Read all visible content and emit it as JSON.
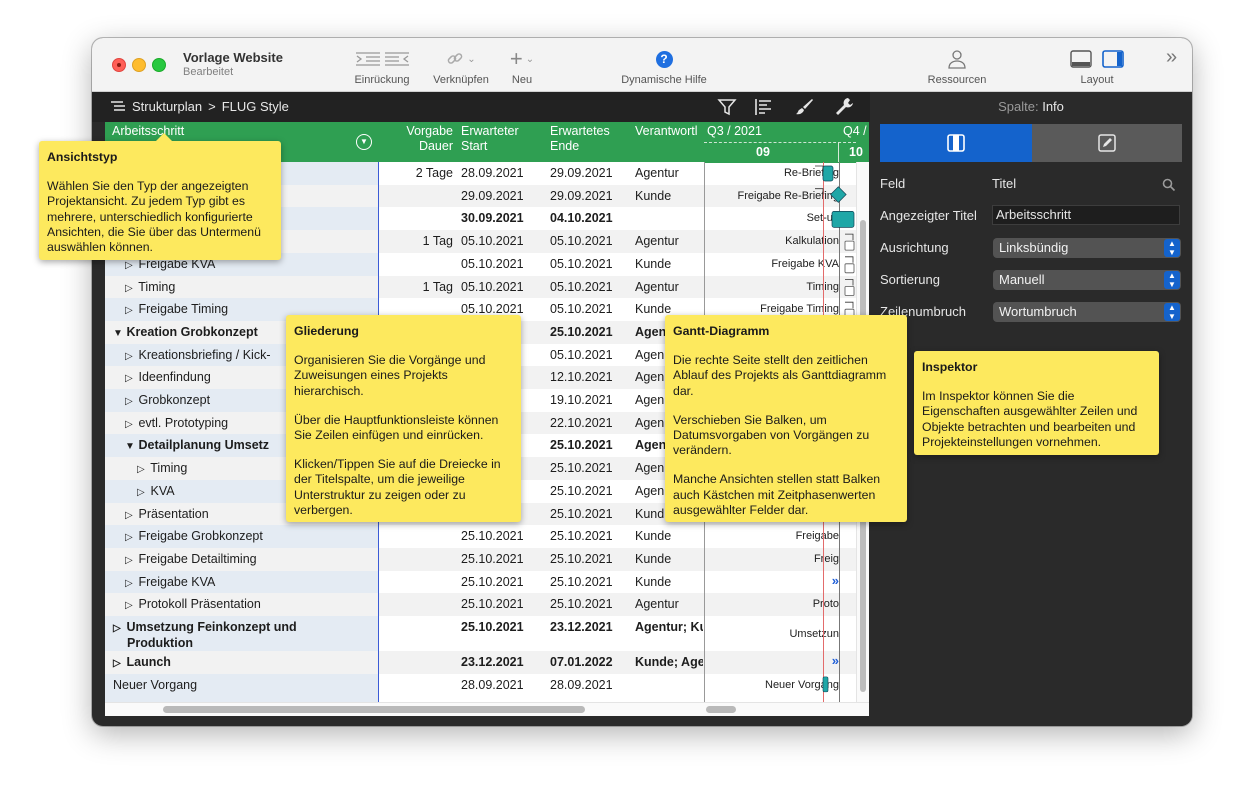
{
  "window": {
    "title": "Vorlage Website",
    "subtitle": "Bearbeitet"
  },
  "toolbar": {
    "indent_label": "Einrückung",
    "link_label": "Verknüpfen",
    "new_label": "Neu",
    "help_label": "Dynamische Hilfe",
    "resources_label": "Ressourcen",
    "layout_label": "Layout",
    "overflow": "»"
  },
  "header": {
    "view_name": "Strukturplan",
    "separator": ">",
    "style_name": "FLUG Style"
  },
  "columns": {
    "title": "Arbeitsschritt",
    "duration_1": "Vorgabe",
    "duration_2": "Dauer",
    "start_1": "Erwarteter",
    "start_2": "Start",
    "end_1": "Erwartetes",
    "end_2": "Ende",
    "resp": "Verantwortl",
    "quarter_1": "Q3 / 2021",
    "quarter_2": "Q4 /",
    "month_1": "09",
    "month_2": "10"
  },
  "rows": [
    {
      "title": "",
      "dur": "2 Tage",
      "start": "28.09.2021",
      "end": "29.09.2021",
      "resp": "Agentur",
      "gantt": "Re-Briefing",
      "bold": false
    },
    {
      "title": "",
      "dur": "",
      "start": "29.09.2021",
      "end": "29.09.2021",
      "resp": "Kunde",
      "gantt": "Freigabe Re-Briefing",
      "bold": false
    },
    {
      "title": "",
      "dur": "",
      "start": "30.09.2021",
      "end": "04.10.2021",
      "resp": "",
      "gantt": "Set-up",
      "bold": true
    },
    {
      "title": "",
      "dur": "1 Tag",
      "start": "05.10.2021",
      "end": "05.10.2021",
      "resp": "Agentur",
      "gantt": "Kalkulation",
      "bold": false
    },
    {
      "title": "Freigabe KVA",
      "dur": "",
      "start": "05.10.2021",
      "end": "05.10.2021",
      "resp": "Kunde",
      "gantt": "Freigabe KVA",
      "bold": false
    },
    {
      "title": "Timing",
      "dur": "1 Tag",
      "start": "05.10.2021",
      "end": "05.10.2021",
      "resp": "Agentur",
      "gantt": "Timing",
      "bold": false
    },
    {
      "title": "Freigabe Timing",
      "dur": "",
      "start": "05.10.2021",
      "end": "05.10.2021",
      "resp": "Kunde",
      "gantt": "Freigabe Timing",
      "bold": false
    },
    {
      "title": "Kreation Grobkonzept",
      "dur": "",
      "start": "",
      "end": "25.10.2021",
      "resp": "Agen",
      "gantt": "",
      "bold": true
    },
    {
      "title": "Kreationsbriefing / Kick-",
      "dur": "",
      "start": "",
      "end": "05.10.2021",
      "resp": "Agen",
      "gantt": "",
      "bold": false
    },
    {
      "title": "Ideenfindung",
      "dur": "",
      "start": "",
      "end": "12.10.2021",
      "resp": "Agen",
      "gantt": "",
      "bold": false
    },
    {
      "title": "Grobkonzept",
      "dur": "",
      "start": "",
      "end": "19.10.2021",
      "resp": "Agen",
      "gantt": "",
      "bold": false
    },
    {
      "title": "evtl. Prototyping",
      "dur": "",
      "start": "",
      "end": "22.10.2021",
      "resp": "Agen",
      "gantt": "",
      "bold": false
    },
    {
      "title": "Detailplanung Umsetz",
      "dur": "",
      "start": "",
      "end": "25.10.2021",
      "resp": "Agen",
      "gantt": "",
      "bold": true
    },
    {
      "title": "Timing",
      "dur": "",
      "start": "",
      "end": "25.10.2021",
      "resp": "Agen",
      "gantt": "",
      "bold": false
    },
    {
      "title": "KVA",
      "dur": "",
      "start": "",
      "end": "25.10.2021",
      "resp": "Agen",
      "gantt": "",
      "bold": false
    },
    {
      "title": "Präsentation",
      "dur": "",
      "start": "",
      "end": "25.10.2021",
      "resp": "Kund",
      "gantt": "",
      "bold": false
    },
    {
      "title": "Freigabe Grobkonzept",
      "dur": "",
      "start": "25.10.2021",
      "end": "25.10.2021",
      "resp": "Kunde",
      "gantt": "Freigabe",
      "bold": false
    },
    {
      "title": "Freigabe Detailtiming",
      "dur": "",
      "start": "25.10.2021",
      "end": "25.10.2021",
      "resp": "Kunde",
      "gantt": "Freig",
      "bold": false
    },
    {
      "title": "Freigabe KVA",
      "dur": "",
      "start": "25.10.2021",
      "end": "25.10.2021",
      "resp": "Kunde",
      "gantt": "»",
      "bold": false
    },
    {
      "title": "Protokoll Präsentation",
      "dur": "",
      "start": "25.10.2021",
      "end": "25.10.2021",
      "resp": "Agentur",
      "gantt": "Proto",
      "bold": false
    },
    {
      "title": "Umsetzung Feinkonzept und",
      "title2": "Produktion",
      "dur": "",
      "start": "25.10.2021",
      "end": "23.12.2021",
      "resp": "Agentur; Ku",
      "gantt": "Umsetzun",
      "bold": true
    },
    {
      "title": "Launch",
      "dur": "",
      "start": "23.12.2021",
      "end": "07.01.2022",
      "resp": "Kunde; Age",
      "gantt": "»",
      "bold": true
    },
    {
      "title": "Neuer Vorgang",
      "dur": "",
      "start": "28.09.2021",
      "end": "28.09.2021",
      "resp": "",
      "gantt": "Neuer Vorgang",
      "bold": false
    }
  ],
  "inspector": {
    "header_prefix": "Spalte:",
    "header_name": "Info",
    "field_label": "Feld",
    "field_value": "Titel",
    "shown_title_label": "Angezeigter Titel",
    "shown_title_value": "Arbeitsschritt",
    "align_label": "Ausrichtung",
    "align_value": "Linksbündig",
    "sort_label": "Sortierung",
    "sort_value": "Manuell",
    "wrap_label": "Zeilenumbruch",
    "wrap_value": "Wortumbruch"
  },
  "callouts": {
    "view_type": {
      "title": "Ansichtstyp",
      "p1": "Wählen Sie den Typ der angezeigten Projektansicht. Zu jedem Typ gibt es mehrere, unterschiedlich konfigurierte Ansichten, die Sie über das Untermenü auswählen können."
    },
    "outline": {
      "title": "Gliederung",
      "p1": "Organisieren Sie die Vorgänge und Zuweisungen eines Projekts hierarchisch.",
      "p2": "Über die Hauptfunktionsleiste können Sie Zeilen einfügen und einrücken.",
      "p3": "Klicken/Tippen Sie auf die Dreiecke in der Titelspalte, um die jeweilige Unterstruktur zu zeigen oder zu verbergen."
    },
    "gantt": {
      "title": "Gantt-Diagramm",
      "p1": "Die rechte Seite stellt den zeitlichen Ablauf des Projekts als Ganttdiagramm dar.",
      "p2": "Verschieben Sie Balken, um Datumsvorgaben von Vorgängen zu verändern.",
      "p3": "Manche Ansichten stellen statt Balken auch Kästchen mit Zeitphasenwerten ausgewählter Felder dar."
    },
    "inspector": {
      "title": "Inspektor",
      "p1": "Im Inspektor können Sie die Eigenschaften ausgewählter Zeilen und Objekte betrachten und bearbeiten und Projekteinstellungen vornehmen."
    }
  },
  "colors": {
    "accent": "#1463cc",
    "table_header": "#2f9f52",
    "callout": "#fde95e",
    "gantt_bar": "#1fa7a7"
  }
}
